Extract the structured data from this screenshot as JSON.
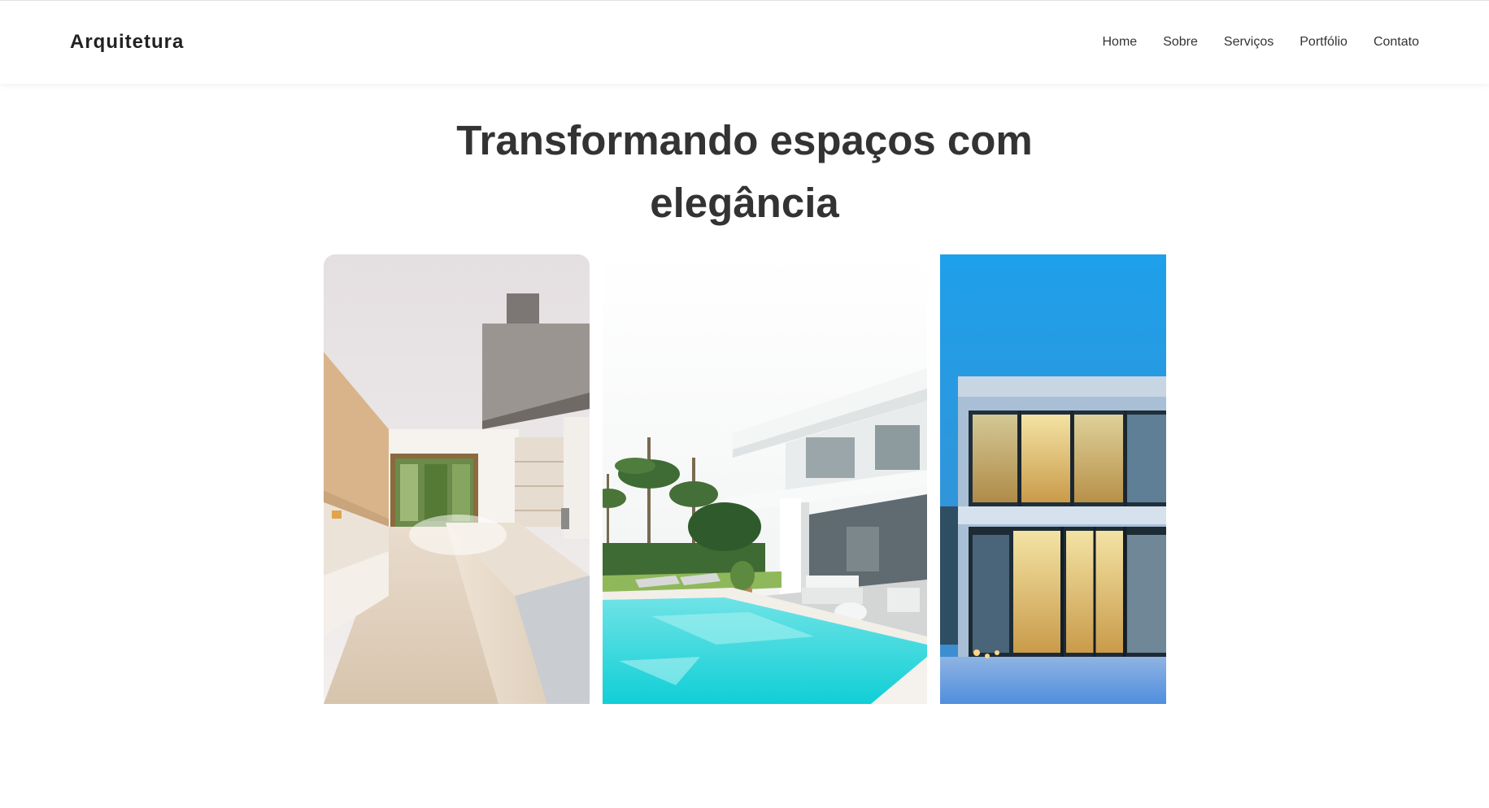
{
  "header": {
    "logo": "Arquitetura",
    "nav": [
      "Home",
      "Sobre",
      "Serviços",
      "Portfólio",
      "Contato"
    ]
  },
  "hero": {
    "title_line1": "Transformando espaços com",
    "title_line2": "elegância"
  },
  "gallery": {
    "images": [
      "kitchen-interior-photo",
      "pool-villa-photo",
      "glass-house-night-photo"
    ]
  },
  "colors": {
    "text": "#333333",
    "logo": "#222222",
    "background": "#ffffff"
  }
}
